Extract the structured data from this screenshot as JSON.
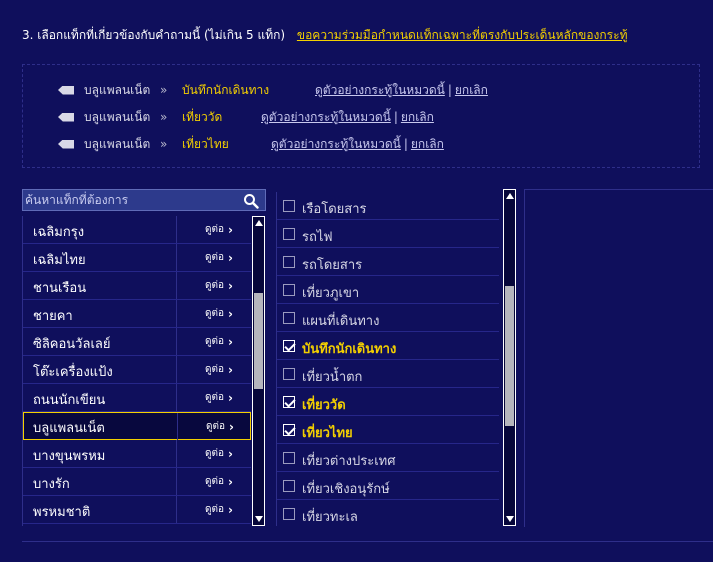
{
  "header": {
    "label": "3. เลือกแท็กที่เกี่ยวข้องกับคำถามนี้ (ไม่เกิน 5 แท็ก)",
    "link": "ขอความร่วมมือกำหนดแท็กเฉพาะที่ตรงกับประเด็นหลักของกระทู้"
  },
  "selected_tags": [
    {
      "parent": "บลูแพลนเน็ต",
      "separator": "»",
      "child": "บันทึกนักเดินทาง",
      "view_link": "ดูตัวอย่างกระทู้ในหมวดนี้",
      "bar": "|",
      "cancel": "ยกเลิก"
    },
    {
      "parent": "บลูแพลนเน็ต",
      "separator": "»",
      "child": "เที่ยววัด",
      "view_link": "ดูตัวอย่างกระทู้ในหมวดนี้",
      "bar": "|",
      "cancel": "ยกเลิก"
    },
    {
      "parent": "บลูแพลนเน็ต",
      "separator": "»",
      "child": "เที่ยวไทย",
      "view_link": "ดูตัวอย่างกระทู้ในหมวดนี้",
      "bar": "|",
      "cancel": "ยกเลิก"
    }
  ],
  "search": {
    "placeholder": "ค้นหาแท็กที่ต้องการ",
    "icon": "search-icon"
  },
  "left_list": {
    "more_label": "ดูต่อ",
    "items": [
      "เฉลิมกรุง",
      "เฉลิมไทย",
      "ชานเรือน",
      "ชายคา",
      "ซิลิคอนวัลเลย์",
      "โต๊ะเครื่องแป้ง",
      "ถนนนักเขียน",
      "บลูแพลนเน็ต",
      "บางขุนพรหม",
      "บางรัก",
      "พรหมชาติ"
    ],
    "active": "บลูแพลนเน็ต"
  },
  "right_list": {
    "items": [
      {
        "label": "เรือโดยสาร",
        "checked": false
      },
      {
        "label": "รถไฟ",
        "checked": false
      },
      {
        "label": "รถโดยสาร",
        "checked": false
      },
      {
        "label": "เที่ยวภูเขา",
        "checked": false
      },
      {
        "label": "แผนที่เดินทาง",
        "checked": false
      },
      {
        "label": "บันทึกนักเดินทาง",
        "checked": true
      },
      {
        "label": "เที่ยวน้ำตก",
        "checked": false
      },
      {
        "label": "เที่ยววัด",
        "checked": true
      },
      {
        "label": "เที่ยวไทย",
        "checked": true
      },
      {
        "label": "เที่ยวต่างประเทศ",
        "checked": false
      },
      {
        "label": "เที่ยวเชิงอนุรักษ์",
        "checked": false
      },
      {
        "label": "เที่ยวทะเล",
        "checked": false
      }
    ]
  },
  "colors": {
    "background": "#0f0f5c",
    "accent": "#f4d000"
  }
}
